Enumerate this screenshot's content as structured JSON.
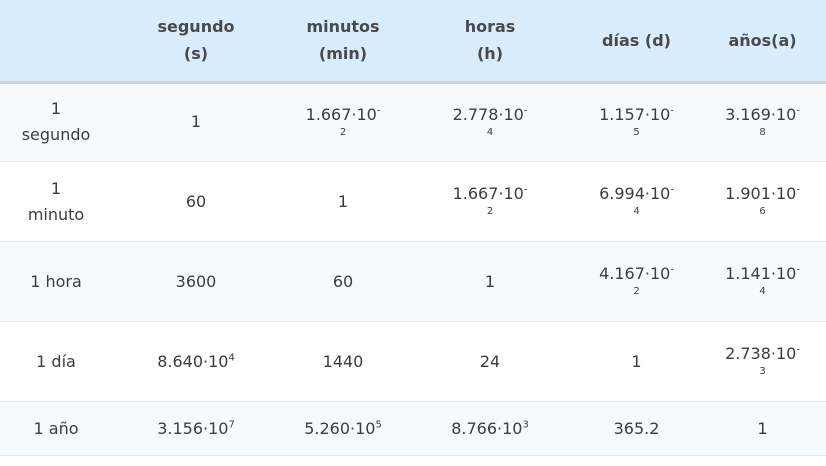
{
  "headers": [
    {
      "line1": "",
      "line2": ""
    },
    {
      "line1": "segundo",
      "line2": "(s)"
    },
    {
      "line1": "minutos",
      "line2": "(min)"
    },
    {
      "line1": "horas",
      "line2": "(h)"
    },
    {
      "line1": "días (d)",
      "line2": ""
    },
    {
      "line1": "años(a)",
      "line2": ""
    }
  ],
  "rows": [
    {
      "label_line1": "1",
      "label_line2": "segundo",
      "cells": [
        {
          "mant": "1",
          "exp": "",
          "style": "plain"
        },
        {
          "mant": "1.667·10",
          "exp": "-",
          "exp2": "2",
          "style": "wrap"
        },
        {
          "mant": "2.778·10",
          "exp": "-",
          "exp2": "4",
          "style": "wrap"
        },
        {
          "mant": "1.157·10",
          "exp": "-",
          "exp2": "5",
          "style": "wrap"
        },
        {
          "mant": "3.169·10",
          "exp": "-",
          "exp2": "8",
          "style": "wrap"
        }
      ]
    },
    {
      "label_line1": "1",
      "label_line2": "minuto",
      "cells": [
        {
          "mant": "60",
          "exp": "",
          "style": "plain"
        },
        {
          "mant": "1",
          "exp": "",
          "style": "plain"
        },
        {
          "mant": "1.667·10",
          "exp": "-",
          "exp2": "2",
          "style": "wrap"
        },
        {
          "mant": "6.994·10",
          "exp": "-",
          "exp2": "4",
          "style": "wrap"
        },
        {
          "mant": "1.901·10",
          "exp": "-",
          "exp2": "6",
          "style": "wrap"
        }
      ]
    },
    {
      "label_line1": "1 hora",
      "label_line2": "",
      "cells": [
        {
          "mant": "3600",
          "exp": "",
          "style": "plain"
        },
        {
          "mant": "60",
          "exp": "",
          "style": "plain"
        },
        {
          "mant": "1",
          "exp": "",
          "style": "plain"
        },
        {
          "mant": "4.167·10",
          "exp": "-",
          "exp2": "2",
          "style": "wrap"
        },
        {
          "mant": "1.141·10",
          "exp": "-",
          "exp2": "4",
          "style": "wrap"
        }
      ]
    },
    {
      "label_line1": "1 día",
      "label_line2": "",
      "cells": [
        {
          "mant": "8.640·10",
          "exp": "4",
          "style": "sup"
        },
        {
          "mant": "1440",
          "exp": "",
          "style": "plain"
        },
        {
          "mant": "24",
          "exp": "",
          "style": "plain"
        },
        {
          "mant": "1",
          "exp": "",
          "style": "plain"
        },
        {
          "mant": "2.738·10",
          "exp": "-",
          "exp2": "3",
          "style": "wrap"
        }
      ]
    },
    {
      "label_line1": "1 año",
      "label_line2": "",
      "cells": [
        {
          "mant": "3.156·10",
          "exp": "7",
          "style": "sup"
        },
        {
          "mant": "5.260·10",
          "exp": "5",
          "style": "sup"
        },
        {
          "mant": "8.766·10",
          "exp": "3",
          "style": "sup"
        },
        {
          "mant": "365.2",
          "exp": "",
          "style": "plain"
        },
        {
          "mant": "1",
          "exp": "",
          "style": "plain"
        }
      ]
    }
  ]
}
